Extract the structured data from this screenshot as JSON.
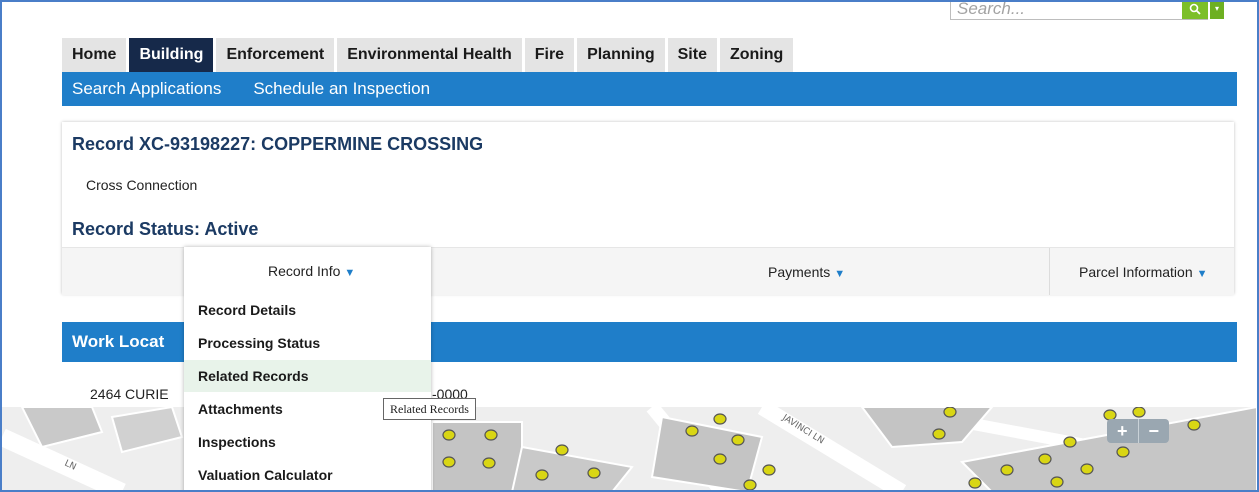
{
  "search": {
    "placeholder": "Search...",
    "button_icon": "search-icon"
  },
  "tabs": [
    {
      "label": "Home"
    },
    {
      "label": "Building",
      "active": true
    },
    {
      "label": "Enforcement"
    },
    {
      "label": "Environmental Health"
    },
    {
      "label": "Fire"
    },
    {
      "label": "Planning"
    },
    {
      "label": "Site"
    },
    {
      "label": "Zoning"
    }
  ],
  "subnav": [
    {
      "label": "Search Applications"
    },
    {
      "label": "Schedule an Inspection"
    }
  ],
  "record": {
    "title": "Record XC-93198227: COPPERMINE CROSSING",
    "type": "Cross Connection",
    "status": "Record Status: Active",
    "dropdowns": {
      "record_info": "Record Info",
      "payments": "Payments",
      "parcel_information": "Parcel Information"
    }
  },
  "record_info_menu": [
    {
      "label": "Record Details"
    },
    {
      "label": "Processing Status"
    },
    {
      "label": "Related Records",
      "hover": true
    },
    {
      "label": "Attachments"
    },
    {
      "label": "Inspections"
    },
    {
      "label": "Valuation Calculator"
    }
  ],
  "work_location": {
    "title": "Work Locat",
    "address_start": "2464 CURIE",
    "address_end": "-0000"
  },
  "tooltip": "Related Records",
  "map": {
    "street_labels": [
      "JAVINCI LN",
      "LN"
    ],
    "zoom_in": "+",
    "zoom_out": "−"
  },
  "colors": {
    "accent_blue": "#1f7ec9",
    "active_tab": "#16294a",
    "heading": "#1b3a63",
    "search_green": "#7cbf2a",
    "map_marker": "#d9d614"
  }
}
